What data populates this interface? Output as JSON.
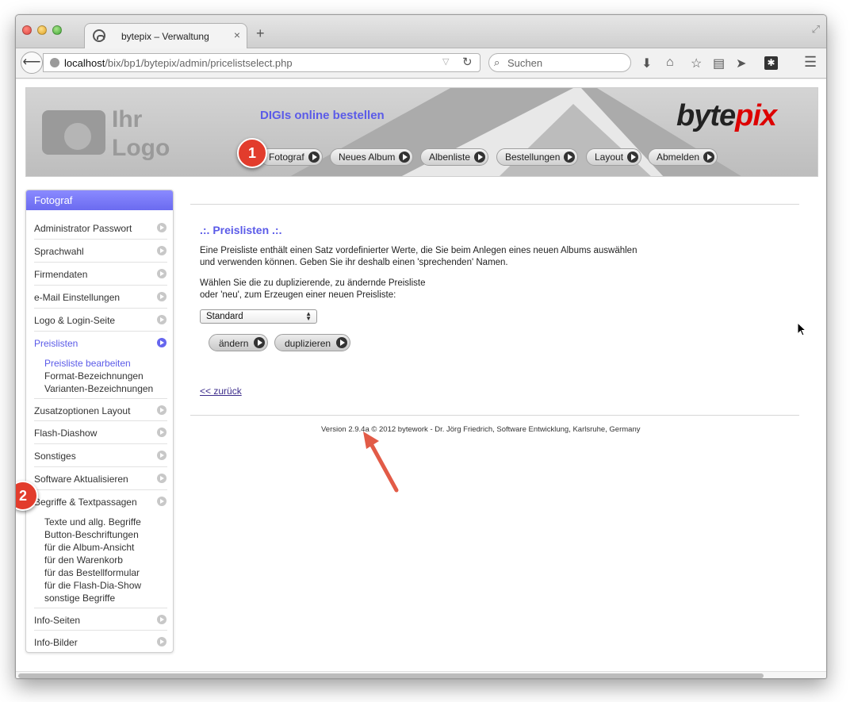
{
  "browser": {
    "tab_title": "bytepix – Verwaltung",
    "tab_close": "×",
    "new_tab": "+",
    "url_host": "localhost",
    "url_path": "/bix/bp1/bytepix/admin/pricelistselect.php",
    "search_placeholder": "Suchen",
    "icons": [
      "back-arrow-icon",
      "globe-icon",
      "reload-icon",
      "search-icon",
      "download-icon",
      "home-icon",
      "bookmark-star-icon",
      "reading-list-icon",
      "send-icon",
      "extension-icon",
      "menu-icon"
    ]
  },
  "header": {
    "logo_line1": "Ihr",
    "logo_line2": "Logo",
    "title": "DIGIs online bestellen",
    "brand_part1": "byte",
    "brand_part2": "pix",
    "nav": [
      "Fotograf",
      "Neues Album",
      "Albenliste",
      "Bestellungen",
      "Layout",
      "Abmelden"
    ]
  },
  "callouts": {
    "one": "1",
    "two": "2"
  },
  "sidebar": {
    "heading": "Fotograf",
    "items": [
      "Administrator Passwort",
      "Sprachwahl",
      "Firmendaten",
      "e-Mail Einstellungen",
      "Logo & Login-Seite",
      "Preislisten",
      "Zusatzoptionen Layout",
      "Flash-Diashow",
      "Sonstiges",
      "Software Aktualisieren",
      "Begriffe & Textpassagen",
      "Info-Seiten",
      "Info-Bilder"
    ],
    "preislisten_sub": [
      "Preisliste bearbeiten",
      "Format-Bezeichnungen",
      "Varianten-Bezeichnungen"
    ],
    "begriffe_sub": [
      "Texte und allg. Begriffe",
      "Button-Beschriftungen",
      "für die Album-Ansicht",
      "für den Warenkorb",
      "für das Bestellformular",
      "für die Flash-Dia-Show",
      "sonstige Begriffe"
    ]
  },
  "main": {
    "title": ".:. Preislisten .:.",
    "para1_line1": "Eine Preisliste enthält einen Satz vordefinierter Werte, die Sie beim Anlegen eines neuen Albums auswählen",
    "para1_line2": "und verwenden können. Geben Sie ihr deshalb einen 'sprechenden' Namen.",
    "para2_line1": "Wählen Sie die zu duplizierende, zu ändernde Preisliste",
    "para2_line2": "oder 'neu', zum Erzeugen einer neuen Preisliste:",
    "select_value": "Standard",
    "btn_change": "ändern",
    "btn_duplicate": "duplizieren",
    "back_link": "<< zurück",
    "version": "Version 2.9.4a © 2012 bytework - Dr. Jörg Friedrich, Software Entwicklung, Karlsruhe, Germany"
  },
  "colors": {
    "accent": "#5b5be8",
    "callout": "#e23c2c",
    "brand_red": "#dd0000"
  }
}
